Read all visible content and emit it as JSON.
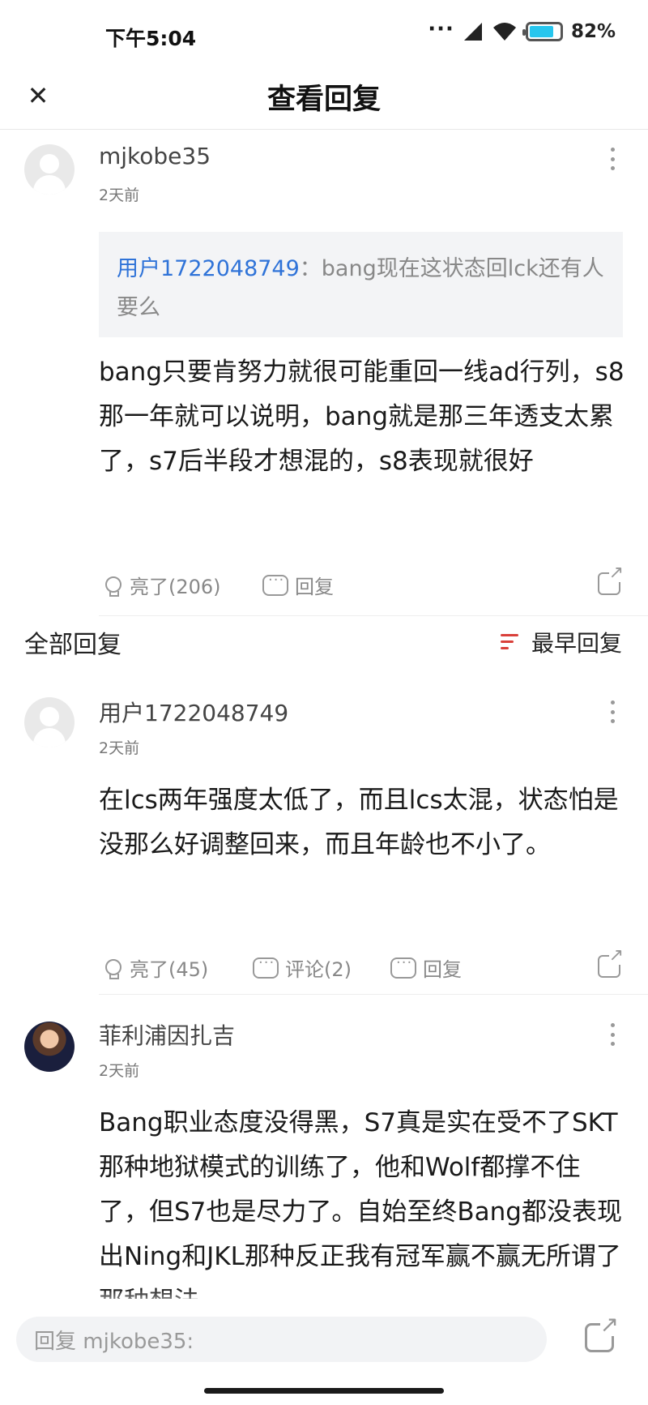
{
  "status_bar": {
    "time": "下午5:04",
    "dots": "···",
    "battery_percent": 82,
    "battery_label": "82%",
    "battery_color": "#27c6ee"
  },
  "header": {
    "title": "查看回复",
    "close_icon": "close-icon"
  },
  "main_comment": {
    "username": "mjkobe35",
    "time": "2天前",
    "quote_user": "用户1722048749",
    "quote_text": "：bang现在这状态回lck还有人要么",
    "content": "bang只要肯努力就很可能重回一线ad行列，s8那一年就可以说明，bang就是那三年透支太累了，s7后半段才想混的，s8表现就很好",
    "like_label": "亮了(206)",
    "reply_label": "回复"
  },
  "section": {
    "title": "全部回复",
    "sort_label": "最早回复",
    "accent_color": "#d9403a"
  },
  "replies": [
    {
      "username": "用户1722048749",
      "time": "2天前",
      "content": "在lcs两年强度太低了，而且lcs太混，状态怕是没那么好调整回来，而且年龄也不小了。",
      "like_label": "亮了(45)",
      "comment_label": "评论(2)",
      "reply_label": "回复"
    },
    {
      "username": "菲利浦因扎吉",
      "time": "2天前",
      "content": "Bang职业态度没得黑，S7真是实在受不了SKT那种地狱模式的训练了，他和Wolf都撑不住了，但S7也是尽力了。自始至终Bang都没表现出Ning和JKL那种反正我有冠军赢不赢无所谓了那种想法"
    }
  ],
  "reply_bar": {
    "placeholder": "回复 mjkobe35:"
  },
  "link_color": "#2f73d8"
}
